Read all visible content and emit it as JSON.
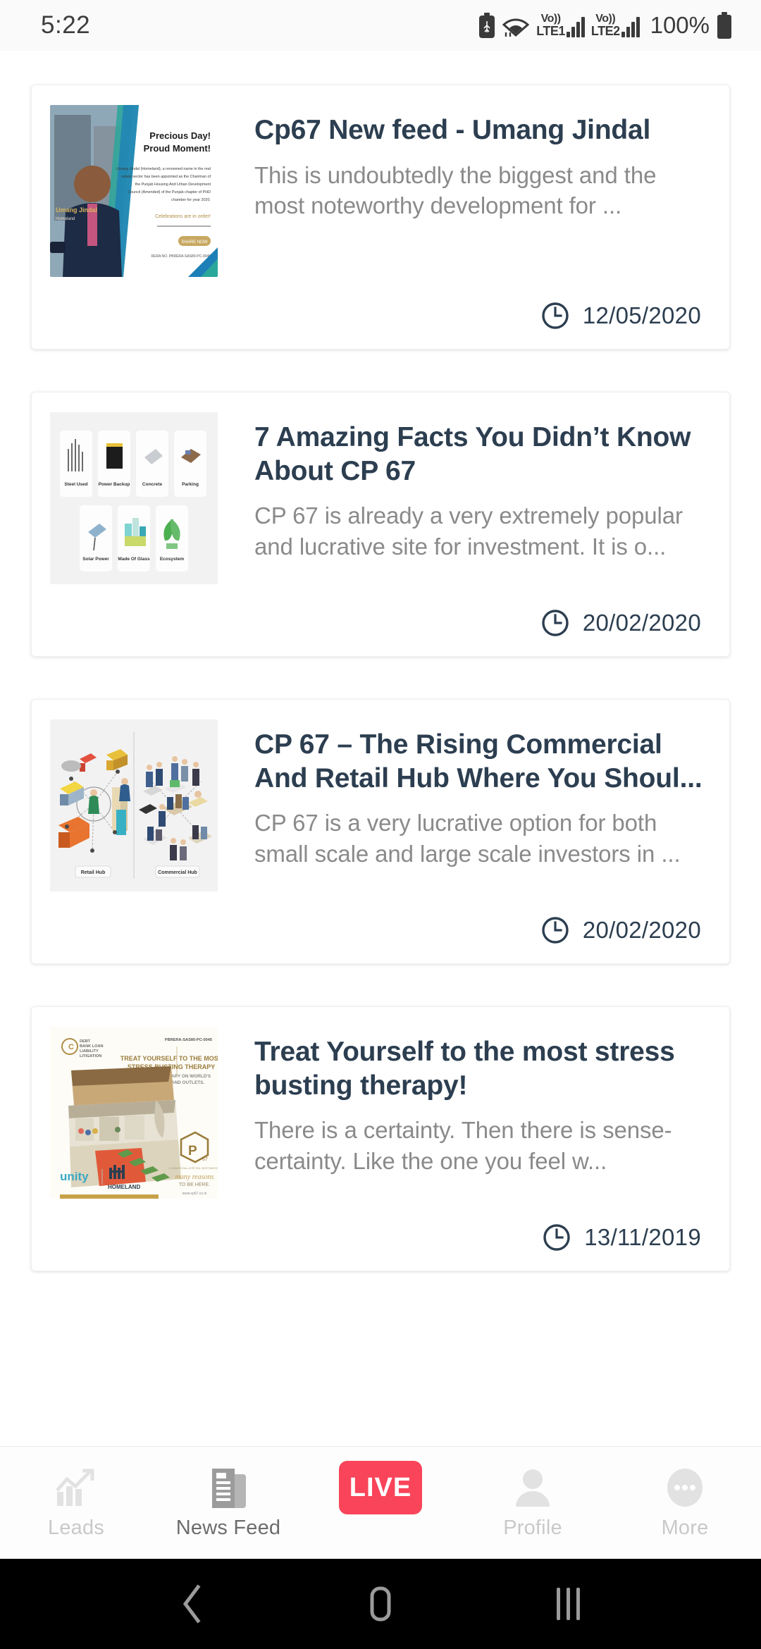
{
  "status_bar": {
    "time": "5:22",
    "battery_percent": "100%",
    "sim1_volte_top": "Vo))",
    "sim1_volte_bottom": "LTE1",
    "sim2_volte_top": "Vo))",
    "sim2_volte_bottom": "LTE2",
    "icons": [
      "battery-saver-icon",
      "wifi-icon",
      "signal-bars-icon",
      "battery-icon"
    ]
  },
  "feed": {
    "items": [
      {
        "title": "Cp67 New feed - Umang Jindal",
        "excerpt": "This is undoubtedly the biggest and the most noteworthy development for ...",
        "date": "12/05/2020",
        "thumbnail_name": "umang-jindal-announcement-thumbnail",
        "thumbnail_alt": "Precious Day! Proud Moment! Umang Jindal Homeland portrait poster"
      },
      {
        "title": "7 Amazing Facts You Didn’t Know About CP 67",
        "excerpt": "CP 67 is already a very extremely popular and lucrative site for investment. It is o...",
        "date": "20/02/2020",
        "thumbnail_name": "cp67-features-grid-thumbnail",
        "thumbnail_alt": "Grid of feature tiles: Steel Used, Power Backup, Concrete, Parking, Solar Power, Made Of Glass, Ecosystem"
      },
      {
        "title": "CP 67 – The Rising Commercial And Retail Hub Where You Shoul...",
        "excerpt": "CP 67 is a very lucrative option for both small scale and large scale investors in ...",
        "date": "20/02/2020",
        "thumbnail_name": "retail-commercial-hub-thumbnail",
        "thumbnail_alt": "Isometric diagram comparing Retail Hub and Commercial Hub"
      },
      {
        "title": "Treat Yourself to the most stress busting therapy!",
        "excerpt": "There is a certainty. Then there is sense-certainty. Like the one you feel w...",
        "date": "13/11/2019",
        "thumbnail_name": "stress-busting-therapy-thumbnail",
        "thumbnail_alt": "Treat Yourself To The Most Stress Busting Therapy mall promo with unity and HOMELAND logos"
      }
    ]
  },
  "tabbar": {
    "items": [
      {
        "label": "Leads",
        "icon": "chart-growth-icon",
        "active": false
      },
      {
        "label": "News Feed",
        "icon": "newspaper-icon",
        "active": true
      },
      {
        "label": "LIVE",
        "icon": "live-badge-icon",
        "active": false
      },
      {
        "label": "Profile",
        "icon": "person-icon",
        "active": false
      },
      {
        "label": "More",
        "icon": "ellipsis-icon",
        "active": false
      }
    ]
  },
  "navbar": {
    "back": "back-chevron",
    "home": "home-square",
    "recents": "recents-bars"
  },
  "colors": {
    "title": "#2c3e50",
    "excerpt": "#8a8a8a",
    "live_red": "#f94459",
    "tab_inactive": "#c9c9c9",
    "tab_active": "#6d6d6d",
    "page_bg": "#ffffff"
  }
}
